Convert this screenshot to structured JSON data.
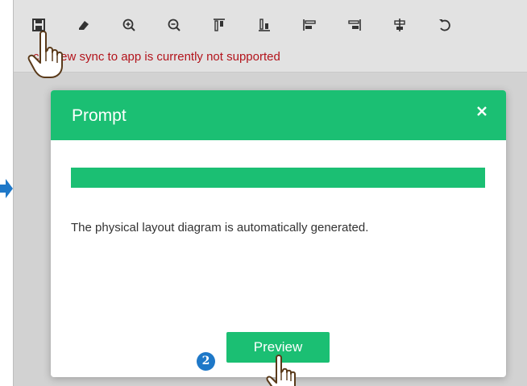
{
  "toolbar": {
    "tools": [
      {
        "name": "save-icon"
      },
      {
        "name": "eraser-icon"
      },
      {
        "name": "zoom-in-icon"
      },
      {
        "name": "zoom-out-icon"
      },
      {
        "name": "align-top-icon"
      },
      {
        "name": "align-bottom-icon"
      },
      {
        "name": "align-left-icon"
      },
      {
        "name": "align-right-icon"
      },
      {
        "name": "align-center-icon"
      },
      {
        "name": "undo-icon"
      }
    ],
    "warning": "cal view sync to app is currently not supported"
  },
  "modal": {
    "title": "Prompt",
    "close_icon": "close-icon",
    "progress_fraction": 1.0,
    "message": "The physical layout diagram is automatically generated.",
    "preview_label": "Preview"
  },
  "step_badge": "2",
  "colors": {
    "accent": "#1bbf73",
    "warning": "#b3141c",
    "badge": "#1e78c8"
  }
}
